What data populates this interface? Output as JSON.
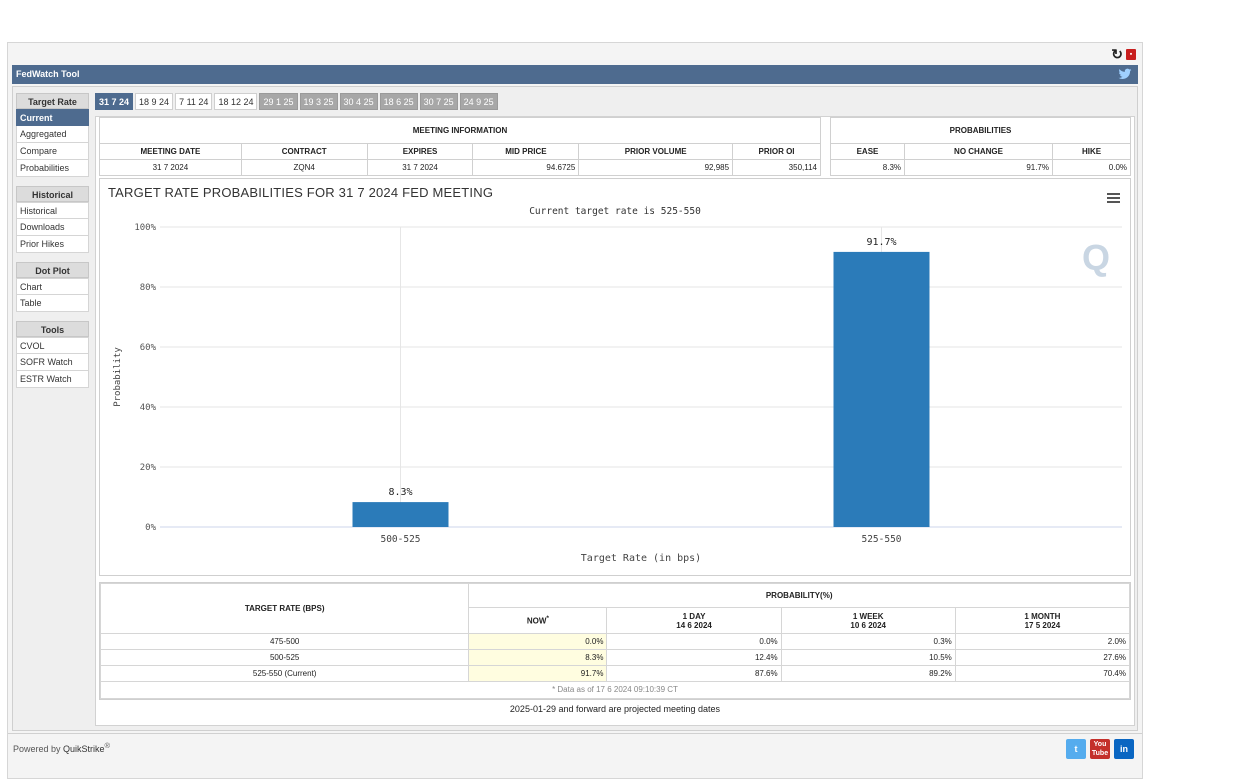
{
  "app": {
    "title": "FedWatch Tool",
    "powered_prefix": "Powered by ",
    "powered_brand": "QuikStrike",
    "powered_mark": "®"
  },
  "icons": {
    "reload": "reload-icon",
    "pdf": "pdf-icon",
    "twitter": "twitter-icon",
    "menu": "hamburger-menu-icon"
  },
  "colors": {
    "accent": "#4e6b8f",
    "bar": "#2b7bb9",
    "now_cell": "#fffde0"
  },
  "sidebar": {
    "sections": [
      {
        "title": "Target Rate",
        "items": [
          "Current",
          "Aggregated",
          "Compare",
          "Probabilities"
        ]
      },
      {
        "title": "Historical",
        "items": [
          "Historical",
          "Downloads",
          "Prior Hikes"
        ]
      },
      {
        "title": "Dot Plot",
        "items": [
          "Chart",
          "Table"
        ]
      },
      {
        "title": "Tools",
        "items": [
          "CVOL",
          "SOFR Watch",
          "ESTR Watch"
        ]
      }
    ],
    "active": "Current"
  },
  "tabs": [
    "31 7 24",
    "18 9 24",
    "7 11 24",
    "18 12 24",
    "29 1 25",
    "19 3 25",
    "30 4 25",
    "18 6 25",
    "30 7 25",
    "24 9 25"
  ],
  "meeting_info": {
    "title": "MEETING INFORMATION",
    "headers": [
      "MEETING DATE",
      "CONTRACT",
      "EXPIRES",
      "MID PRICE",
      "PRIOR VOLUME",
      "PRIOR OI"
    ],
    "values": [
      "31 7 2024",
      "ZQN4",
      "31 7 2024",
      "94.6725",
      "92,985",
      "350,114"
    ]
  },
  "probabilities": {
    "title": "PROBABILITIES",
    "headers": [
      "EASE",
      "NO CHANGE",
      "HIKE"
    ],
    "values": [
      "8.3%",
      "91.7%",
      "0.0%"
    ]
  },
  "chart_data": {
    "type": "bar",
    "title": "TARGET RATE PROBABILITIES FOR 31 7 2024 FED MEETING",
    "subtitle": "Current target rate is 525-550",
    "xlabel": "Target Rate (in bps)",
    "ylabel": "Probability",
    "categories": [
      "500-525",
      "525-550"
    ],
    "values": [
      8.3,
      91.7
    ],
    "data_labels": [
      "8.3%",
      "91.7%"
    ],
    "ylim": [
      0,
      100
    ],
    "yticks": [
      "0%",
      "20%",
      "40%",
      "60%",
      "80%",
      "100%"
    ],
    "grid": true,
    "legend": "none"
  },
  "prob_table": {
    "col_title": "TARGET RATE (BPS)",
    "group_title": "PROBABILITY(%)",
    "now_label": "NOW",
    "now_mark": "*",
    "periods": [
      {
        "label": "1 DAY",
        "date": "14 6 2024"
      },
      {
        "label": "1 WEEK",
        "date": "10 6 2024"
      },
      {
        "label": "1 MONTH",
        "date": "17 5 2024"
      }
    ],
    "rows": [
      {
        "rate": "475-500",
        "now": "0.0%",
        "day": "0.0%",
        "week": "0.3%",
        "month": "2.0%"
      },
      {
        "rate": "500-525",
        "now": "8.3%",
        "day": "12.4%",
        "week": "10.5%",
        "month": "27.6%"
      },
      {
        "rate": "525-550 (Current)",
        "now": "91.7%",
        "day": "87.6%",
        "week": "89.2%",
        "month": "70.4%"
      }
    ],
    "footnote": "* Data as of 17 6 2024 09:10:39 CT"
  },
  "projected_note": "2025-01-29 and forward are projected meeting dates",
  "social": {
    "twitter": "t",
    "youtube_top": "You",
    "youtube_bottom": "Tube",
    "linkedin": "in"
  }
}
